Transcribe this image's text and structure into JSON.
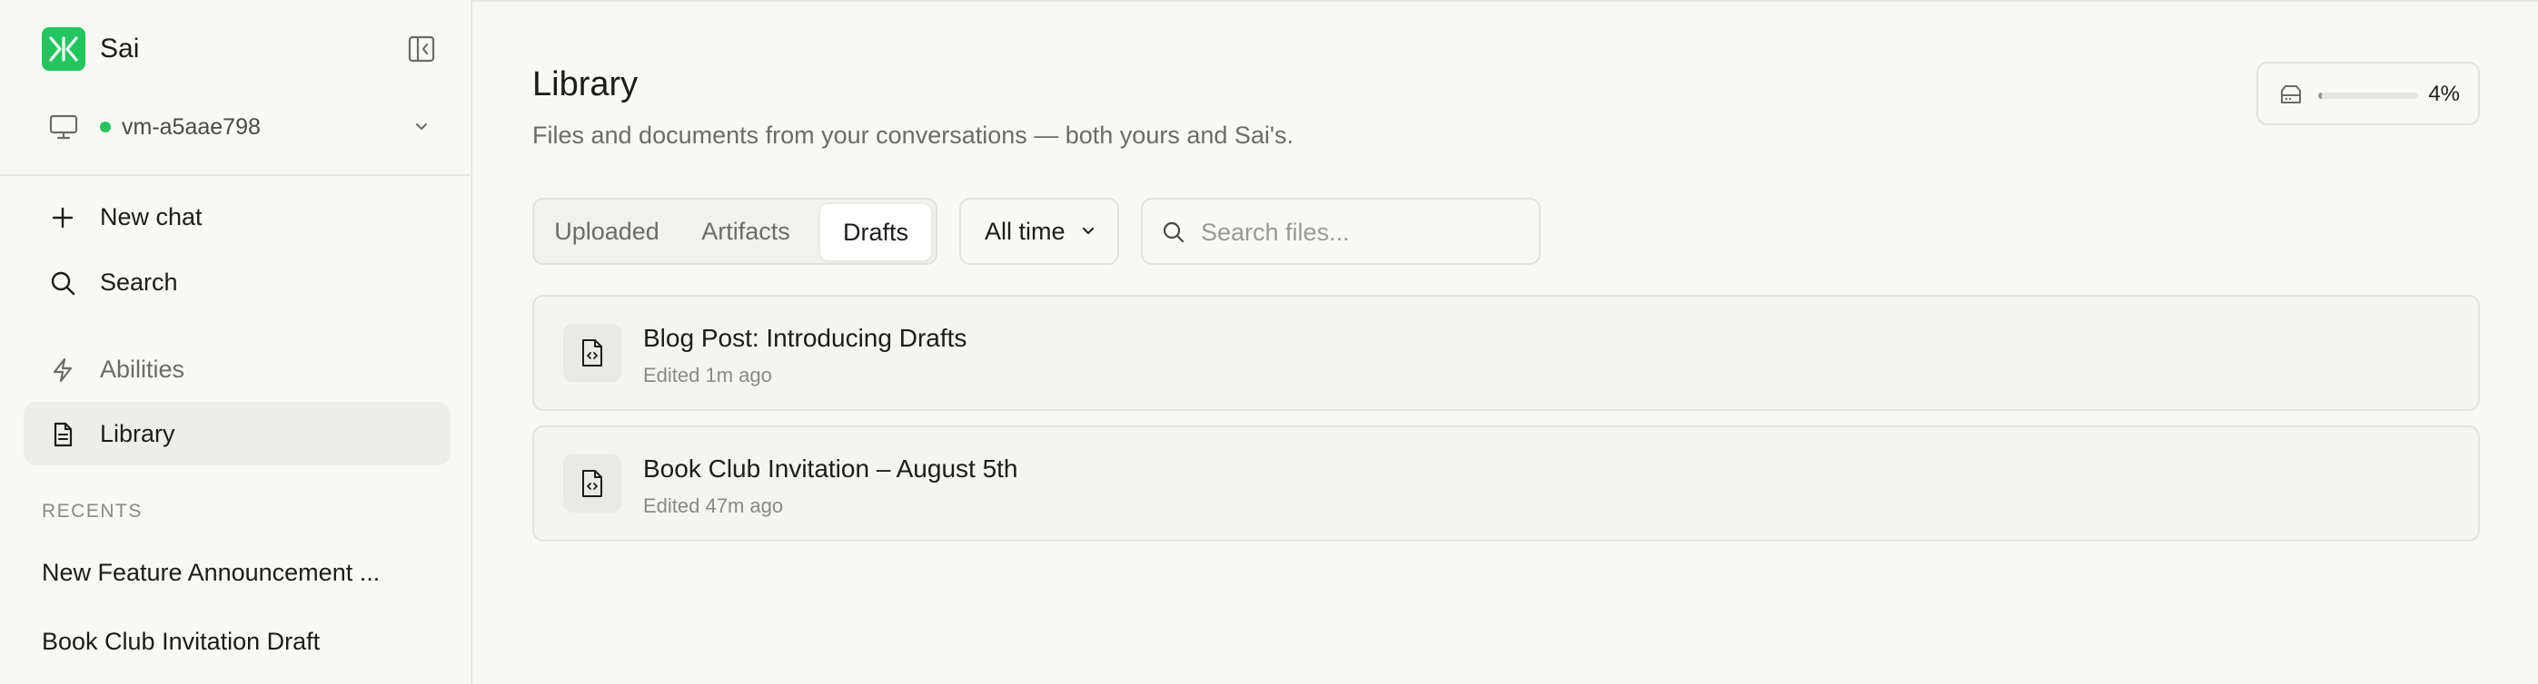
{
  "app": {
    "name": "Sai",
    "brand_color": "#22c55e"
  },
  "sidebar": {
    "vm": {
      "name": "vm-a5aae798",
      "status_color": "#22c55e"
    },
    "nav": [
      {
        "label": "New chat",
        "icon": "plus-icon"
      },
      {
        "label": "Search",
        "icon": "search-icon"
      },
      {
        "label": "Abilities",
        "icon": "lightning-icon"
      },
      {
        "label": "Library",
        "icon": "document-icon",
        "active": true
      }
    ],
    "recents_label": "RECENTS",
    "recents": [
      "New Feature Announcement ...",
      "Book Club Invitation Draft"
    ]
  },
  "main": {
    "title": "Library",
    "subtitle": "Files and documents from your conversations — both yours and Sai's.",
    "storage": {
      "percent_label": "4%",
      "percent": 4
    },
    "tabs": [
      "Uploaded",
      "Artifacts",
      "Drafts"
    ],
    "active_tab": "Drafts",
    "time_filter": "All time",
    "search": {
      "placeholder": "Search files...",
      "value": ""
    },
    "files": [
      {
        "title": "Blog Post: Introducing Drafts",
        "meta": "Edited 1m ago",
        "icon": "code-file-icon"
      },
      {
        "title": "Book Club Invitation – August 5th",
        "meta": "Edited 47m ago",
        "icon": "code-file-icon"
      }
    ]
  }
}
